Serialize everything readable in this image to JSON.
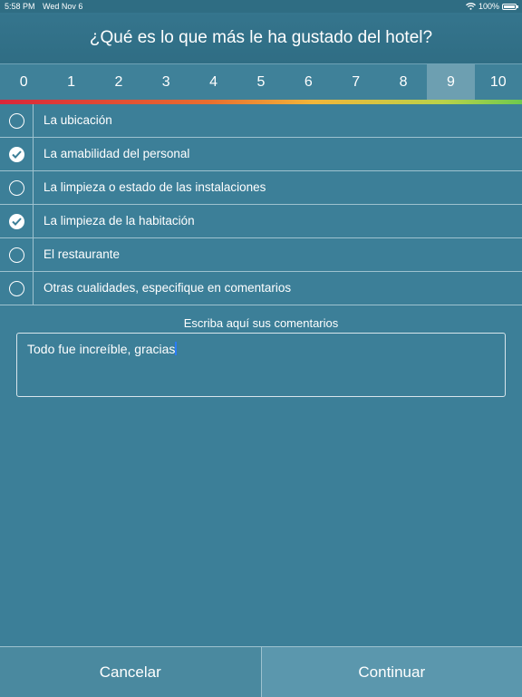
{
  "status": {
    "time": "5:58 PM",
    "date": "Wed Nov 6",
    "battery": "100%"
  },
  "header": {
    "title": "¿Qué es lo que más le ha gustado del hotel?"
  },
  "scale": {
    "values": [
      "0",
      "1",
      "2",
      "3",
      "4",
      "5",
      "6",
      "7",
      "8",
      "9",
      "10"
    ],
    "selected": "9"
  },
  "options": [
    {
      "label": "La ubicación",
      "checked": false
    },
    {
      "label": "La amabilidad del personal",
      "checked": true
    },
    {
      "label": "La limpieza o estado de las instalaciones",
      "checked": false
    },
    {
      "label": "La limpieza de la habitación",
      "checked": true
    },
    {
      "label": "El restaurante",
      "checked": false
    },
    {
      "label": "Otras cualidades, especifique en comentarios",
      "checked": false
    }
  ],
  "comments": {
    "label": "Escriba aquí sus comentarios",
    "value": "Todo fue increíble, gracias"
  },
  "footer": {
    "cancel_label": "Cancelar",
    "continue_label": "Continuar"
  },
  "colors": {
    "background": "#3c7f98",
    "selected_score": "#6d9fb1",
    "caret": "#2a7cf6"
  }
}
